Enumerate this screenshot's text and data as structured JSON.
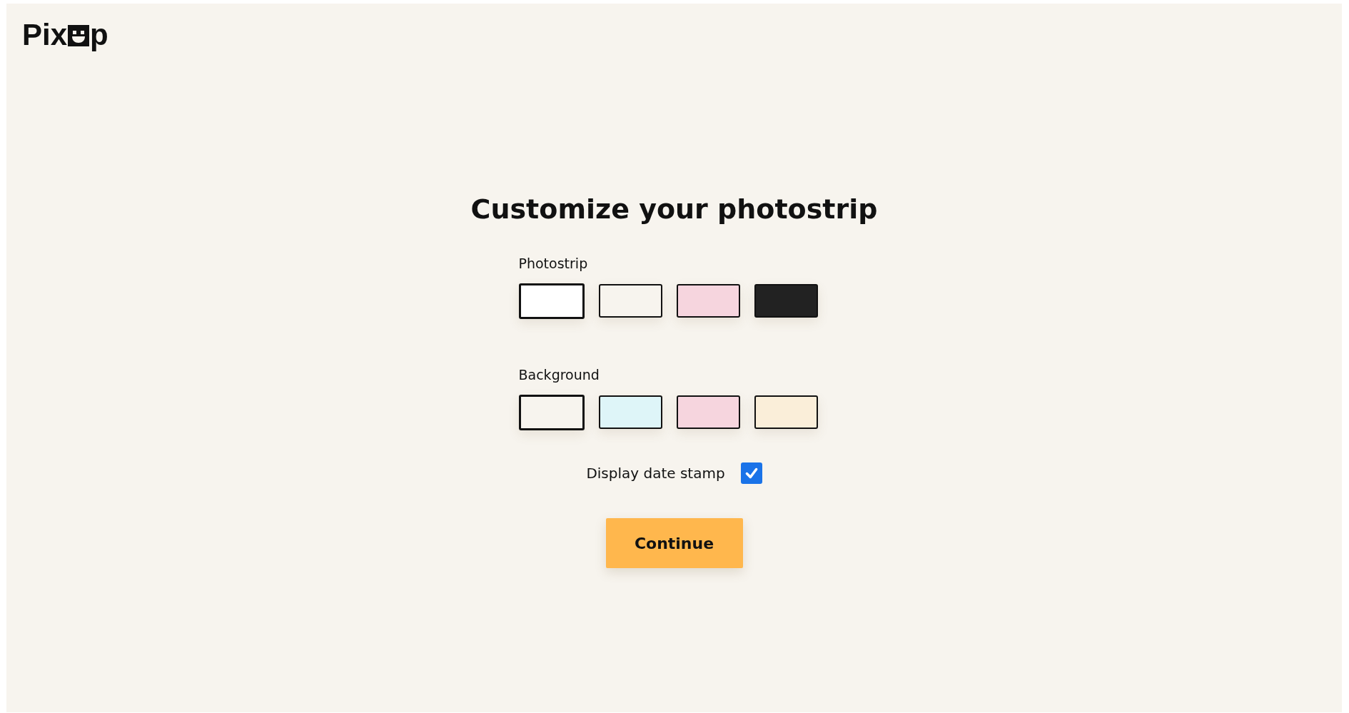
{
  "logo": {
    "before": "Pix",
    "after": "p"
  },
  "title": "Customize your photostrip",
  "groups": [
    {
      "label": "Photostrip",
      "swatches": [
        {
          "color": "#ffffff",
          "selected": true
        },
        {
          "color": "#f7f4ee",
          "selected": false
        },
        {
          "color": "#f6d5de",
          "selected": false
        },
        {
          "color": "#222222",
          "selected": false
        }
      ]
    },
    {
      "label": "Background",
      "swatches": [
        {
          "color": "#f7f4ee",
          "selected": true
        },
        {
          "color": "#def5f8",
          "selected": false
        },
        {
          "color": "#f6d5de",
          "selected": false
        },
        {
          "color": "#faeed9",
          "selected": false
        }
      ]
    }
  ],
  "date_stamp": {
    "label": "Display date stamp",
    "checked": true
  },
  "button": "Continue"
}
